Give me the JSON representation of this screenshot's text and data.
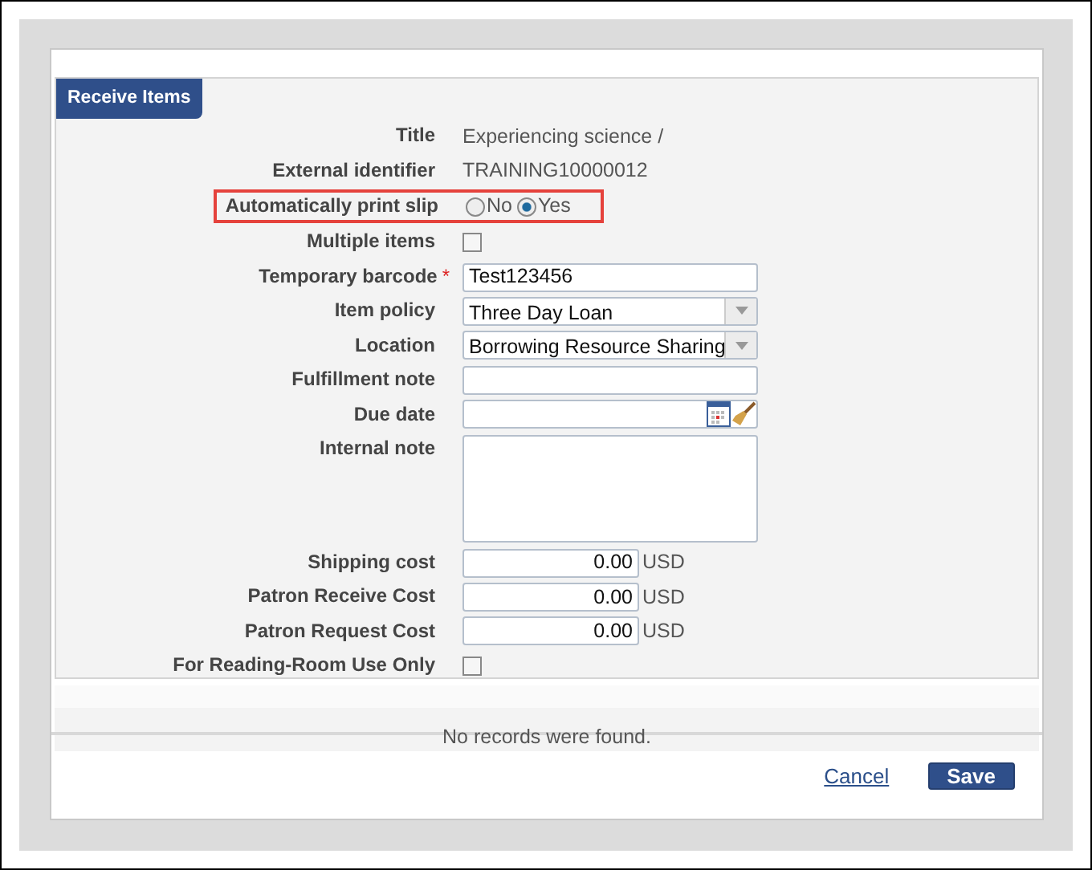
{
  "panel": {
    "title": "Receive Items"
  },
  "fields": [
    {
      "kind": "text",
      "label": "Title",
      "value": "Experiencing science /"
    },
    {
      "kind": "text",
      "label": "External identifier",
      "value": "TRAINING10000012"
    },
    {
      "kind": "radio",
      "label": "Automatically print slip",
      "highlighted": true,
      "options": [
        {
          "label": "No",
          "selected": false
        },
        {
          "label": "Yes",
          "selected": true
        }
      ]
    },
    {
      "kind": "checkbox",
      "label": "Multiple items",
      "checked": false
    },
    {
      "kind": "input",
      "label": "Temporary barcode",
      "required": true,
      "required_mark": "*",
      "value": "Test123456"
    },
    {
      "kind": "select",
      "label": "Item policy",
      "value": "Three Day Loan"
    },
    {
      "kind": "select",
      "label": "Location",
      "value": "Borrowing Resource Sharing"
    },
    {
      "kind": "input",
      "label": "Fulfillment note"
    },
    {
      "kind": "date",
      "label": "Due date"
    },
    {
      "kind": "textarea",
      "label": "Internal note"
    },
    {
      "kind": "currency",
      "label": "Shipping cost",
      "value": "0.00",
      "currency": "USD"
    },
    {
      "kind": "currency",
      "label": "Patron Receive Cost",
      "value": "0.00",
      "currency": "USD"
    },
    {
      "kind": "currency",
      "label": "Patron Request Cost",
      "value": "0.00",
      "currency": "USD"
    },
    {
      "kind": "checkbox",
      "label": "For Reading-Room Use Only",
      "checked": false
    }
  ],
  "results": {
    "message": "No records were found."
  },
  "buttons": {
    "cancel": "Cancel",
    "save": "Save"
  }
}
